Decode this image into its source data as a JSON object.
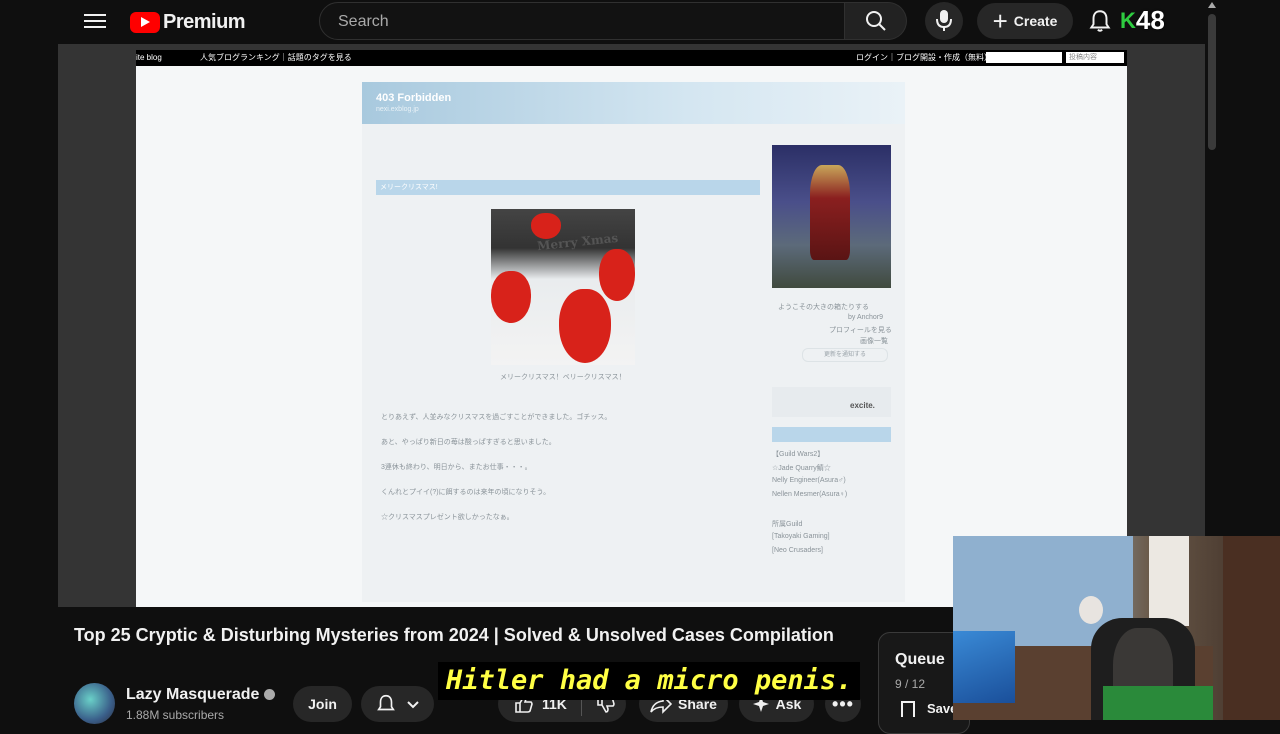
{
  "header": {
    "logo_text": "Premium",
    "search_placeholder": "Search",
    "create_label": "Create",
    "badge_letter": "K",
    "badge_number": "48"
  },
  "embedded_page": {
    "topbar_left": "ite blog",
    "topbar_middle": "人気ブログランキング｜話題のタグを見る",
    "topbar_right": "ログイン｜ブログ開設・作成（無料）",
    "topbar_search_text": "投稿内容",
    "blog_title": "403 Forbidden",
    "blog_url": "nexi.exblog.jp",
    "post_title": "メリークリスマス!",
    "cake_text": "Merry Xmas",
    "cake_caption": "メリークリスマス！ベリークリスマス！",
    "paragraphs": [
      "とりあえず、人並みなクリスマスを過ごすことができました。ゴチッス。",
      "あと、やっぱり新日の苺は酸っぱすぎると思いました。",
      "3連休も終わり、明日から、またお仕事・・・。",
      "くんれとプイイ(?)に餌するのは来年の頃になりそう。",
      "☆クリスマスプレゼント欲しかったなぁ。"
    ],
    "sidebar_lines": [
      "ようこその大きの箱たりする",
      "by Anchor9",
      "プロフィールを見る",
      "画像一覧"
    ],
    "sidebar_button": "更新を通知する",
    "excite_text": "excite.",
    "guild_lines": [
      "【Guild Wars2】",
      "☆Jade Quarry鯖☆",
      "Nelly Engineer(Asura♂)",
      "Nellen Mesmer(Asura♀)",
      "",
      "所属Guild",
      "[Takoyaki Gaming]",
      "[Neo Crusaders]"
    ]
  },
  "video": {
    "title": "Top 25 Cryptic & Disturbing Mysteries from 2024 | Solved & Unsolved Cases Compilation",
    "subtitle": "Hitler had a micro penis."
  },
  "channel": {
    "name": "Lazy Masquerade",
    "subscribers": "1.88M subscribers",
    "join_label": "Join"
  },
  "actions": {
    "likes": "11K",
    "share_label": "Share",
    "ask_label": "Ask"
  },
  "queue": {
    "label": "Queue",
    "count": "9 / 12",
    "save_label": "Save"
  }
}
